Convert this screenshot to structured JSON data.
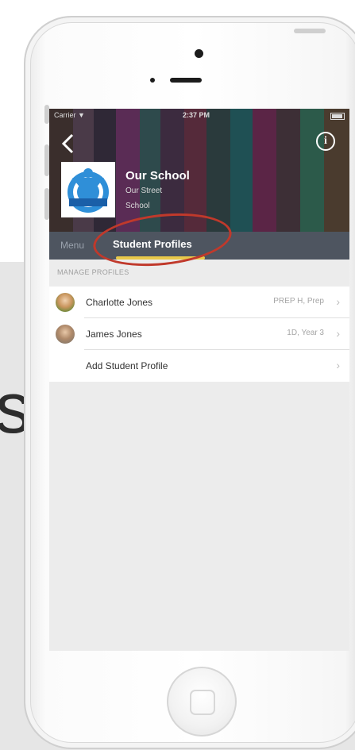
{
  "slide": {
    "partial_letter": "s"
  },
  "status_bar": {
    "carrier": "Carrier ▼",
    "time": "2:37 PM"
  },
  "header": {
    "back_icon": "chevron-left-icon",
    "info_icon": "info-icon",
    "school_name": "Our School",
    "street": "Our Street",
    "city": "School"
  },
  "tabs": [
    {
      "label": "Menu"
    },
    {
      "label": "Student Profiles"
    }
  ],
  "colors": {
    "header_bg": "#2a1e24",
    "tabbar_bg": "#4e5560",
    "tab_underline": "#e8c94a",
    "annotation": "#c0392b"
  },
  "manage": {
    "header": "MANAGE PROFILES",
    "rows": [
      {
        "name": "Charlotte  Jones",
        "detail": "PREP H, Prep"
      },
      {
        "name": "James Jones",
        "detail": "1D, Year 3"
      },
      {
        "name": "Add Student Profile",
        "detail": ""
      }
    ]
  }
}
